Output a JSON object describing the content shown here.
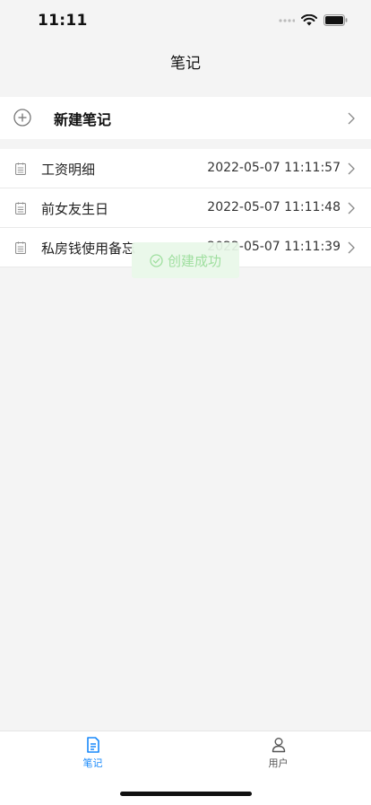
{
  "status_bar": {
    "time": "11:11"
  },
  "nav": {
    "title": "笔记"
  },
  "new_note": {
    "label": "新建笔记"
  },
  "notes": [
    {
      "title": "工资明细",
      "time": "2022-05-07 11:11:57"
    },
    {
      "title": "前女友生日",
      "time": "2022-05-07 11:11:48"
    },
    {
      "title": "私房钱使用备忘",
      "time": "2022-05-07 11:11:39"
    }
  ],
  "toast": {
    "message": "创建成功"
  },
  "tab_bar": {
    "tabs": [
      {
        "label": "笔记",
        "active": true
      },
      {
        "label": "用户",
        "active": false
      }
    ]
  },
  "colors": {
    "accent": "#1989fa",
    "toast_text": "#9fdf9f",
    "background": "#f4f4f4"
  }
}
